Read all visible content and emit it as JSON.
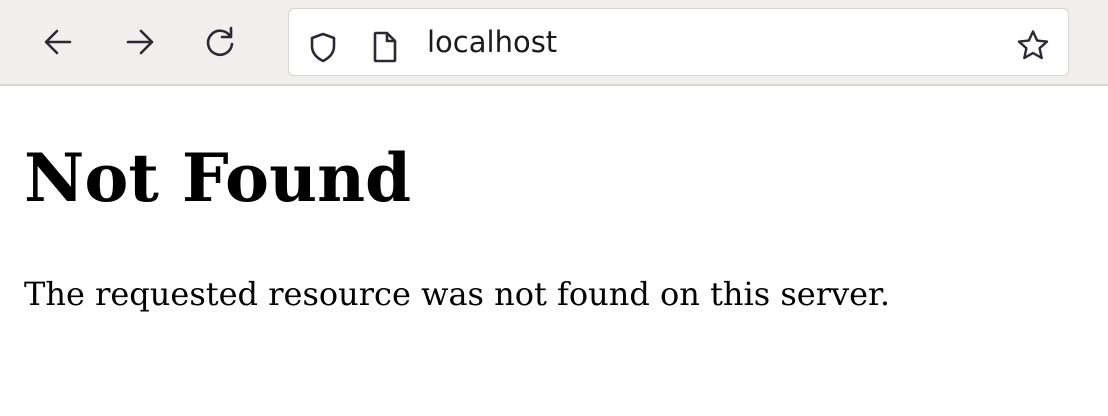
{
  "browser": {
    "nav": {
      "back_icon": "arrow-left-icon",
      "forward_icon": "arrow-right-icon",
      "reload_icon": "reload-icon"
    },
    "url_bar": {
      "security_icon": "shield-icon",
      "page_icon": "page-icon",
      "url": "localhost",
      "bookmark_icon": "star-icon"
    }
  },
  "page": {
    "heading": "Not Found",
    "message": "The requested resource was not found on this server."
  },
  "colors": {
    "toolbar_bg": "#f0efee",
    "icon": "#2b2a33",
    "text": "#000000"
  }
}
